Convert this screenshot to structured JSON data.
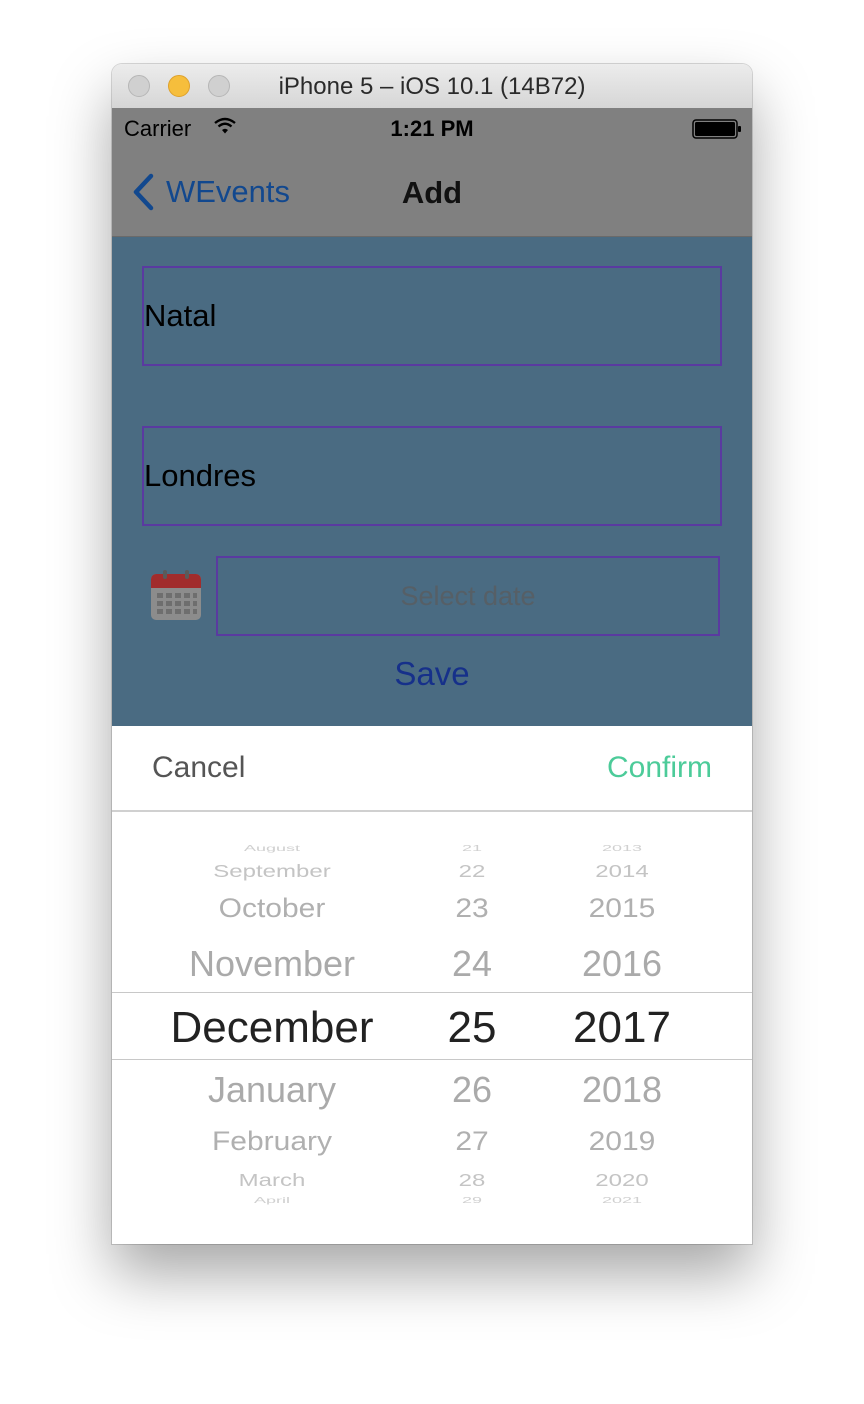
{
  "window": {
    "title": "iPhone 5 – iOS 10.1 (14B72)"
  },
  "status_bar": {
    "carrier": "Carrier",
    "time": "1:21 PM",
    "wifi_icon": "wifi-icon",
    "battery_icon": "battery-icon"
  },
  "nav": {
    "back_label": "WEvents",
    "title": "Add"
  },
  "form": {
    "from_value": "Natal",
    "to_value": "Londres",
    "date_placeholder": "Select date",
    "calendar_icon": "calendar-icon",
    "save_label": "Save"
  },
  "picker": {
    "cancel_label": "Cancel",
    "confirm_label": "Confirm",
    "months": [
      "August",
      "September",
      "October",
      "November",
      "December",
      "January",
      "February",
      "March",
      "April"
    ],
    "days": [
      "21",
      "22",
      "23",
      "24",
      "25",
      "26",
      "27",
      "28",
      "29"
    ],
    "years": [
      "2013",
      "2014",
      "2015",
      "2016",
      "2017",
      "2018",
      "2019",
      "2020",
      "2021"
    ],
    "selected": {
      "month": "December",
      "day": "25",
      "year": "2017"
    }
  },
  "colors": {
    "nav_background": "#808080",
    "content_background": "#4a6b82",
    "back_text": "#12488e",
    "save_text": "#16308a",
    "confirm_text": "#4ccb99",
    "field_border": "#5a3aa0"
  }
}
